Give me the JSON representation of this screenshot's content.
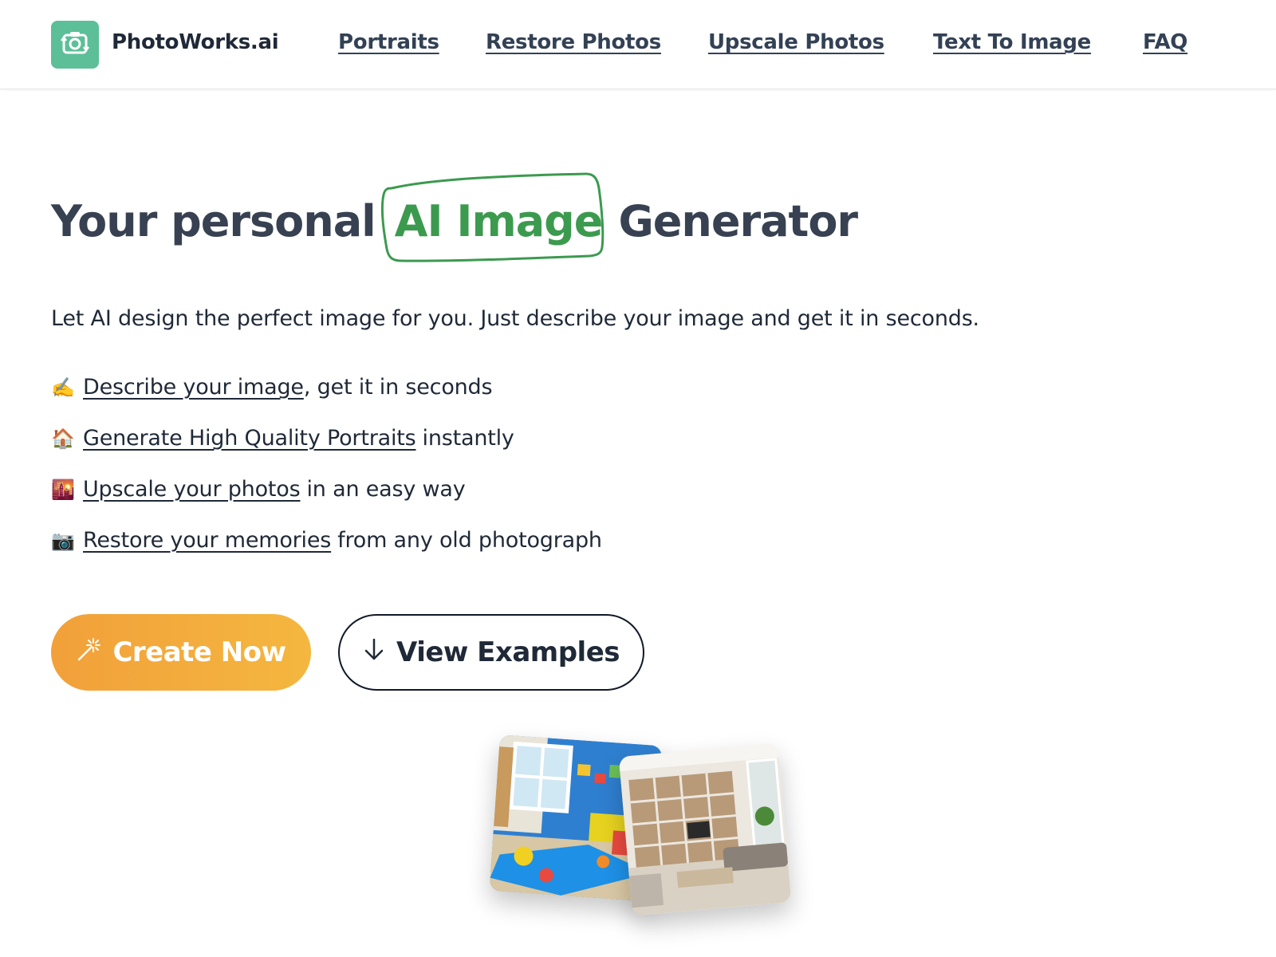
{
  "header": {
    "brand": "PhotoWorks.ai",
    "nav": [
      {
        "label": "Portraits"
      },
      {
        "label": "Restore Photos"
      },
      {
        "label": "Upscale Photos"
      },
      {
        "label": "Text To Image"
      },
      {
        "label": "FAQ"
      }
    ]
  },
  "hero": {
    "headline_before": "Your personal",
    "headline_highlight": "AI Image",
    "headline_after": "Generator",
    "subtitle": "Let AI design the perfect image for you. Just describe your image and get it in seconds.",
    "features": [
      {
        "emoji": "✍️",
        "link": "Describe your image",
        "rest": ", get it in seconds"
      },
      {
        "emoji": "🏠",
        "link": "Generate High Quality Portraits",
        "rest": "instantly"
      },
      {
        "emoji": "🌇",
        "link": "Upscale your photos",
        "rest": "in an easy way"
      },
      {
        "emoji": "📷",
        "link": "Restore your memories",
        "rest": "from any old photograph"
      }
    ],
    "create_button": "Create Now",
    "view_button": "View Examples"
  },
  "colors": {
    "accent_green": "#3c9a4f",
    "logo_green": "#5cbf98",
    "button_orange": "#f2a03a"
  },
  "icons": {
    "logo": "camera-rotate-icon",
    "create": "magic-wand-icon",
    "view": "arrow-down-icon"
  }
}
